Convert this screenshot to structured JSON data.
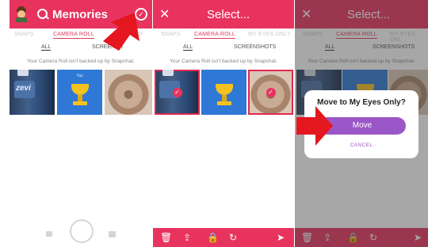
{
  "panel1": {
    "title": "Memories",
    "tabs": [
      "SNAPS",
      "CAMERA ROLL",
      "MY EYES ONLY"
    ],
    "tab_partial": "LY",
    "subtabs": [
      "ALL",
      "SCREENSHOTS"
    ],
    "subtab_partial": "SCREENSH",
    "note": "Your Camera Roll isn't backed up by Snapchat.",
    "thumb_text": {
      "zevia": "zevi",
      "trophy": "Yay"
    }
  },
  "panel2": {
    "title": "Select...",
    "tabs": [
      "SNAPS",
      "CAMERA ROLL",
      "MY EYES ONLY"
    ],
    "subtabs": [
      "ALL",
      "SCREENSHOTS"
    ],
    "note": "Your Camera Roll isn't backed up by Snapchat."
  },
  "panel3": {
    "title": "Select...",
    "tabs": [
      "SNAPS",
      "CAMERA ROLL",
      "MY EYES ONL"
    ],
    "subtabs": [
      "ALL",
      "SCREENSHOTS"
    ],
    "note": "Your Camera Roll isn't backed up by Snapchat.",
    "dialog": {
      "title": "Move to My Eyes Only?",
      "confirm": "Move",
      "cancel": "CANCEL"
    }
  },
  "colors": {
    "brand": "#e8335f",
    "accent": "#9a57c7",
    "annotation_arrow": "#e4161e"
  },
  "icons": [
    "bitmoji-icon",
    "search-icon",
    "check-circle-icon",
    "close-icon",
    "trash-icon",
    "share-icon",
    "lock-icon",
    "refresh-icon",
    "send-icon",
    "gallery-icon",
    "capture-button"
  ]
}
